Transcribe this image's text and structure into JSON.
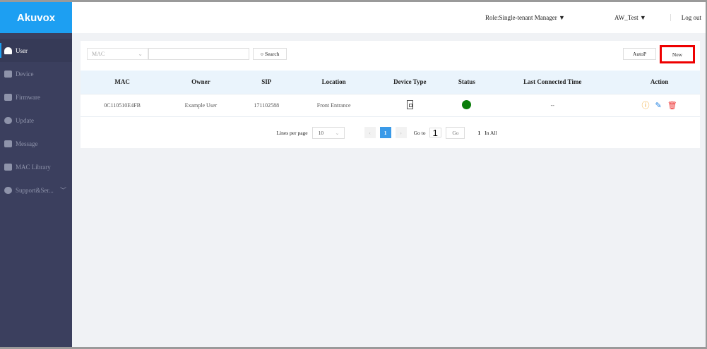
{
  "brand": "Akuvox",
  "header": {
    "role": "Role:Single-tenant Manager ▼",
    "user": "AW_Test ▼",
    "logout": "Log out"
  },
  "sidebar": {
    "items": [
      {
        "label": "User",
        "icon": "user-icon"
      },
      {
        "label": "Device",
        "icon": "device-icon"
      },
      {
        "label": "Firmware",
        "icon": "puzzle-icon"
      },
      {
        "label": "Update",
        "icon": "cloud-upload-icon"
      },
      {
        "label": "Message",
        "icon": "message-icon"
      },
      {
        "label": "MAC Library",
        "icon": "library-icon"
      },
      {
        "label": "Support&Ser...",
        "icon": "support-icon"
      }
    ]
  },
  "toolbar": {
    "filter": "MAC",
    "search_value": "",
    "search": "○ Search",
    "autop": "AutoP",
    "new": "New"
  },
  "table": {
    "columns": [
      "MAC",
      "Owner",
      "SIP",
      "Location",
      "Device Type",
      "Status",
      "Last Connected Time",
      "Action"
    ],
    "rows": [
      {
        "mac": "0C110510E4FB",
        "owner": "Example User",
        "sip": "171102588",
        "location": "Front Entrance",
        "device_type": "door-phone-icon",
        "status": "online",
        "status_color": "#0a7d0a",
        "last_connected": "--"
      }
    ]
  },
  "pagination": {
    "lines_label": "Lines per page",
    "lines": "10",
    "prev": "‹",
    "page": "1",
    "next": "›",
    "goto_label": "Go to",
    "goto_value": "1",
    "go": "Go",
    "total_count": "1",
    "total_label": "In All"
  }
}
